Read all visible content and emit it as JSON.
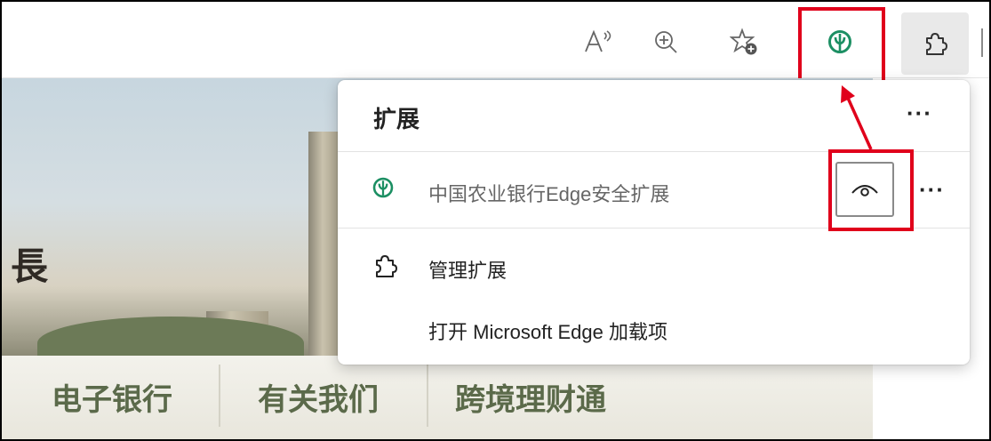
{
  "toolbar": {
    "read_aloud_icon": "read-aloud-icon",
    "zoom_icon": "zoom-in-icon",
    "favorites_icon": "add-favorite-icon",
    "abc_icon": "abc-bank-icon",
    "extensions_icon": "puzzle-icon"
  },
  "page": {
    "banner_char": "長",
    "nav": [
      "电子银行",
      "有关我们",
      "跨境理财通"
    ]
  },
  "popup": {
    "title": "扩展",
    "more_label": "···",
    "extension_name": "中国农业银行Edge安全扩展",
    "manage_label": "管理扩展",
    "open_addons_label": "打开 Microsoft Edge 加载项"
  },
  "colors": {
    "highlight": "#e0001b",
    "abc_green": "#1c8f63"
  }
}
